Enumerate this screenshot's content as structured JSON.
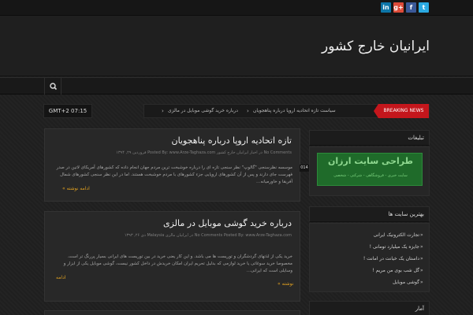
{
  "topbar": {
    "social": [
      {
        "name": "linkedin",
        "label": "in",
        "color": "#0e76a8"
      },
      {
        "name": "google-plus",
        "label": "g+",
        "color": "#dd4b39"
      },
      {
        "name": "facebook",
        "label": "f",
        "color": "#3b5998"
      },
      {
        "name": "twitter",
        "label": "t",
        "color": "#2ba9e1"
      }
    ]
  },
  "header": {
    "site_title": "ایرانیان خارج کشور"
  },
  "nav": {
    "search_icon": "search-icon"
  },
  "clock": "GMT+2 07:15",
  "ticker": {
    "label": "BREAKING NEWS",
    "items": [
      "سیاست تازه اتحادیه اروپا درباره پناهجویان",
      "درباره خرید گوشی موبایل در مالزی"
    ],
    "arrow": "›"
  },
  "posts": [
    {
      "title": "تازه اتحادیه اروپا درباره پناهجویان",
      "meta": "No Comments   در اخبار ایرانیان خارج کشور   Posted By: www.Arze-Taghaza.com   فروردین ۲۹, ۱۳۹۴",
      "excerpt": "موسسه نظرسنجی \"گالوپ\" نظر سنجی تازه ای را درباره خوشبخت ترین مردم جهان انجام داده که کشورهای آمریکای لاتین در صدر فهرست جای دارند و پس از آن کشورهای اروپایی جزء کشورهای با مردم خوشبخت هستند. اما در این نظر سنجی کشورهای شمال آفریقا و خاورمیانه…",
      "read_more": "ادامه نوشته »",
      "edge_text": ""
    },
    {
      "title": "درباره خرید گوشی موبایل در مالزی",
      "meta": "No Comments   Posted By: www.Arze-Taghaza.com   در ایرانیان مالزی Malaysia   دی ۲۶, ۱۳۹۳",
      "excerpt": "خرید یکی از لذتهای گردشگران و توریست ها می باشد. و این کار یعنی خرید در بین توریست های ایرانی بسیار پررنگ تر است. مخصوصا خرید سوغاتی یا خرید لوازمی که بدلیل تحریم ایران امکان خریدش در داخل کشور نیست، گوشی موبایل یکی از ابزار و وسایلی است که ایرانی…",
      "read_more": "ادامه",
      "read_more_2": "نوشته »",
      "edge_text": ""
    }
  ],
  "post_tag": "014",
  "sidebar": {
    "ads": {
      "title": "تبلیغات",
      "banner_title": "طراحی سایت ارزان",
      "banner_sub": "سایت خبری - فروشگاهی - شرکتی - شخصی"
    },
    "links": {
      "title": "بهترین سایت ها",
      "items": [
        "تجارت الکترونیک ایرانی",
        "جایزه یک میلیارد تومانی !",
        "داستان یک خیانت در امانت !",
        "گل شب بوی من مریم !",
        "گوشی موبایل"
      ],
      "bullet": "»"
    },
    "archive": {
      "title": "آمار"
    }
  }
}
